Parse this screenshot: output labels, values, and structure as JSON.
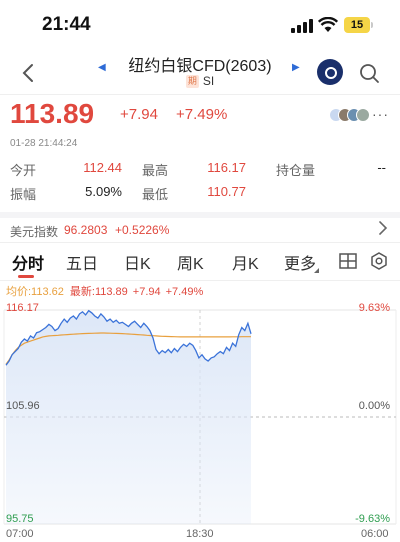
{
  "status_bar": {
    "time": "21:44",
    "battery": "15",
    "icons": [
      "signal-icon",
      "wifi-icon",
      "battery-icon"
    ]
  },
  "header": {
    "title": "纽约白银CFD(2603)",
    "tag": "期",
    "symbol": "SI",
    "icons": [
      "back-icon",
      "prev-instrument-icon",
      "next-instrument-icon",
      "app-logo",
      "search-icon"
    ]
  },
  "quote": {
    "price": "113.89",
    "change": "+7.94",
    "change_pct": "+7.49%",
    "timestamp": "01-28 21:44:24",
    "more": "···"
  },
  "stats": {
    "open_label": "今开",
    "open_value": "112.44",
    "high_label": "最高",
    "high_value": "116.17",
    "oi_label": "持仓量",
    "oi_value": "--",
    "amp_label": "振幅",
    "amp_value": "5.09%",
    "low_label": "最低",
    "low_value": "110.77"
  },
  "usd_index": {
    "label": "美元指数",
    "value": "96.2803",
    "change_pct": "+0.5226%"
  },
  "tabs": [
    {
      "label": "分时",
      "active": true
    },
    {
      "label": "五日",
      "active": false
    },
    {
      "label": "日K",
      "active": false
    },
    {
      "label": "周K",
      "active": false
    },
    {
      "label": "月K",
      "active": false
    },
    {
      "label": "更多",
      "active": false
    }
  ],
  "legend": {
    "avg_text": "均价:113.62",
    "latest_label": "最新:",
    "latest_value": "113.89",
    "latest_change": "+7.94",
    "latest_pct": "+7.49%"
  },
  "colors": {
    "up": "#e0483e",
    "down": "#2e9d4f",
    "price_line": "#3b73d9",
    "avg_line": "#e8a03e",
    "fill": "#dbe6f7"
  },
  "chart_data": {
    "type": "line",
    "x_ticks": [
      "07:00",
      "18:30",
      "06:00"
    ],
    "y_left_ticks": [
      "116.17",
      "105.96",
      "95.75"
    ],
    "y_right_ticks": [
      "9.63%",
      "0.00%",
      "-9.63%"
    ],
    "ylim": [
      95.75,
      116.17
    ],
    "series": [
      {
        "key": "price",
        "values": [
          110.9,
          111.3,
          111.9,
          112.2,
          112.5,
          113.1,
          113.4,
          113.2,
          113.7,
          113.5,
          114.0,
          114.1,
          114.3,
          114.5,
          114.8,
          114.6,
          114.2,
          114.4,
          114.9,
          115.3,
          115.0,
          115.4,
          115.6,
          115.3,
          115.8,
          116.0,
          115.7,
          116.1,
          115.9,
          115.6,
          115.4,
          115.8,
          115.5,
          115.1,
          115.3,
          115.0,
          115.2,
          114.9,
          115.0,
          114.8,
          114.6,
          114.9,
          115.1,
          114.8,
          114.5,
          114.9,
          114.6,
          114.2,
          113.5,
          112.4,
          112.0,
          112.3,
          112.1,
          112.4,
          112.1,
          112.5,
          112.2,
          112.6,
          112.9,
          112.7,
          113.0,
          112.8,
          112.3,
          111.6,
          111.9,
          111.5,
          111.3,
          111.6,
          111.7,
          112.0,
          112.2,
          112.0,
          112.6,
          112.3,
          113.0,
          112.7,
          113.8,
          114.5,
          114.2,
          114.9,
          113.9
        ]
      },
      {
        "key": "average",
        "values": [
          111.0,
          111.4,
          111.9,
          112.3,
          112.6,
          112.8,
          113.0,
          113.1,
          113.2,
          113.3,
          113.4,
          113.5,
          113.6,
          113.65,
          113.7,
          113.72,
          113.74,
          113.76,
          113.78,
          113.8,
          113.82,
          113.84,
          113.86,
          113.88,
          113.9,
          113.92,
          113.93,
          113.94,
          113.95,
          113.96,
          113.97,
          113.98,
          113.98,
          113.97,
          113.96,
          113.95,
          113.94,
          113.93,
          113.92,
          113.9,
          113.88,
          113.86,
          113.84,
          113.82,
          113.8,
          113.78,
          113.76,
          113.74,
          113.72,
          113.7,
          113.68,
          113.66,
          113.65,
          113.64,
          113.63,
          113.62,
          113.61,
          113.6,
          113.6,
          113.6,
          113.6,
          113.6,
          113.6,
          113.6,
          113.6,
          113.6,
          113.6,
          113.6,
          113.6,
          113.6,
          113.6,
          113.6,
          113.6,
          113.6,
          113.61,
          113.61,
          113.61,
          113.62,
          113.62,
          113.62,
          113.62
        ]
      }
    ],
    "session_fraction": 0.63
  }
}
